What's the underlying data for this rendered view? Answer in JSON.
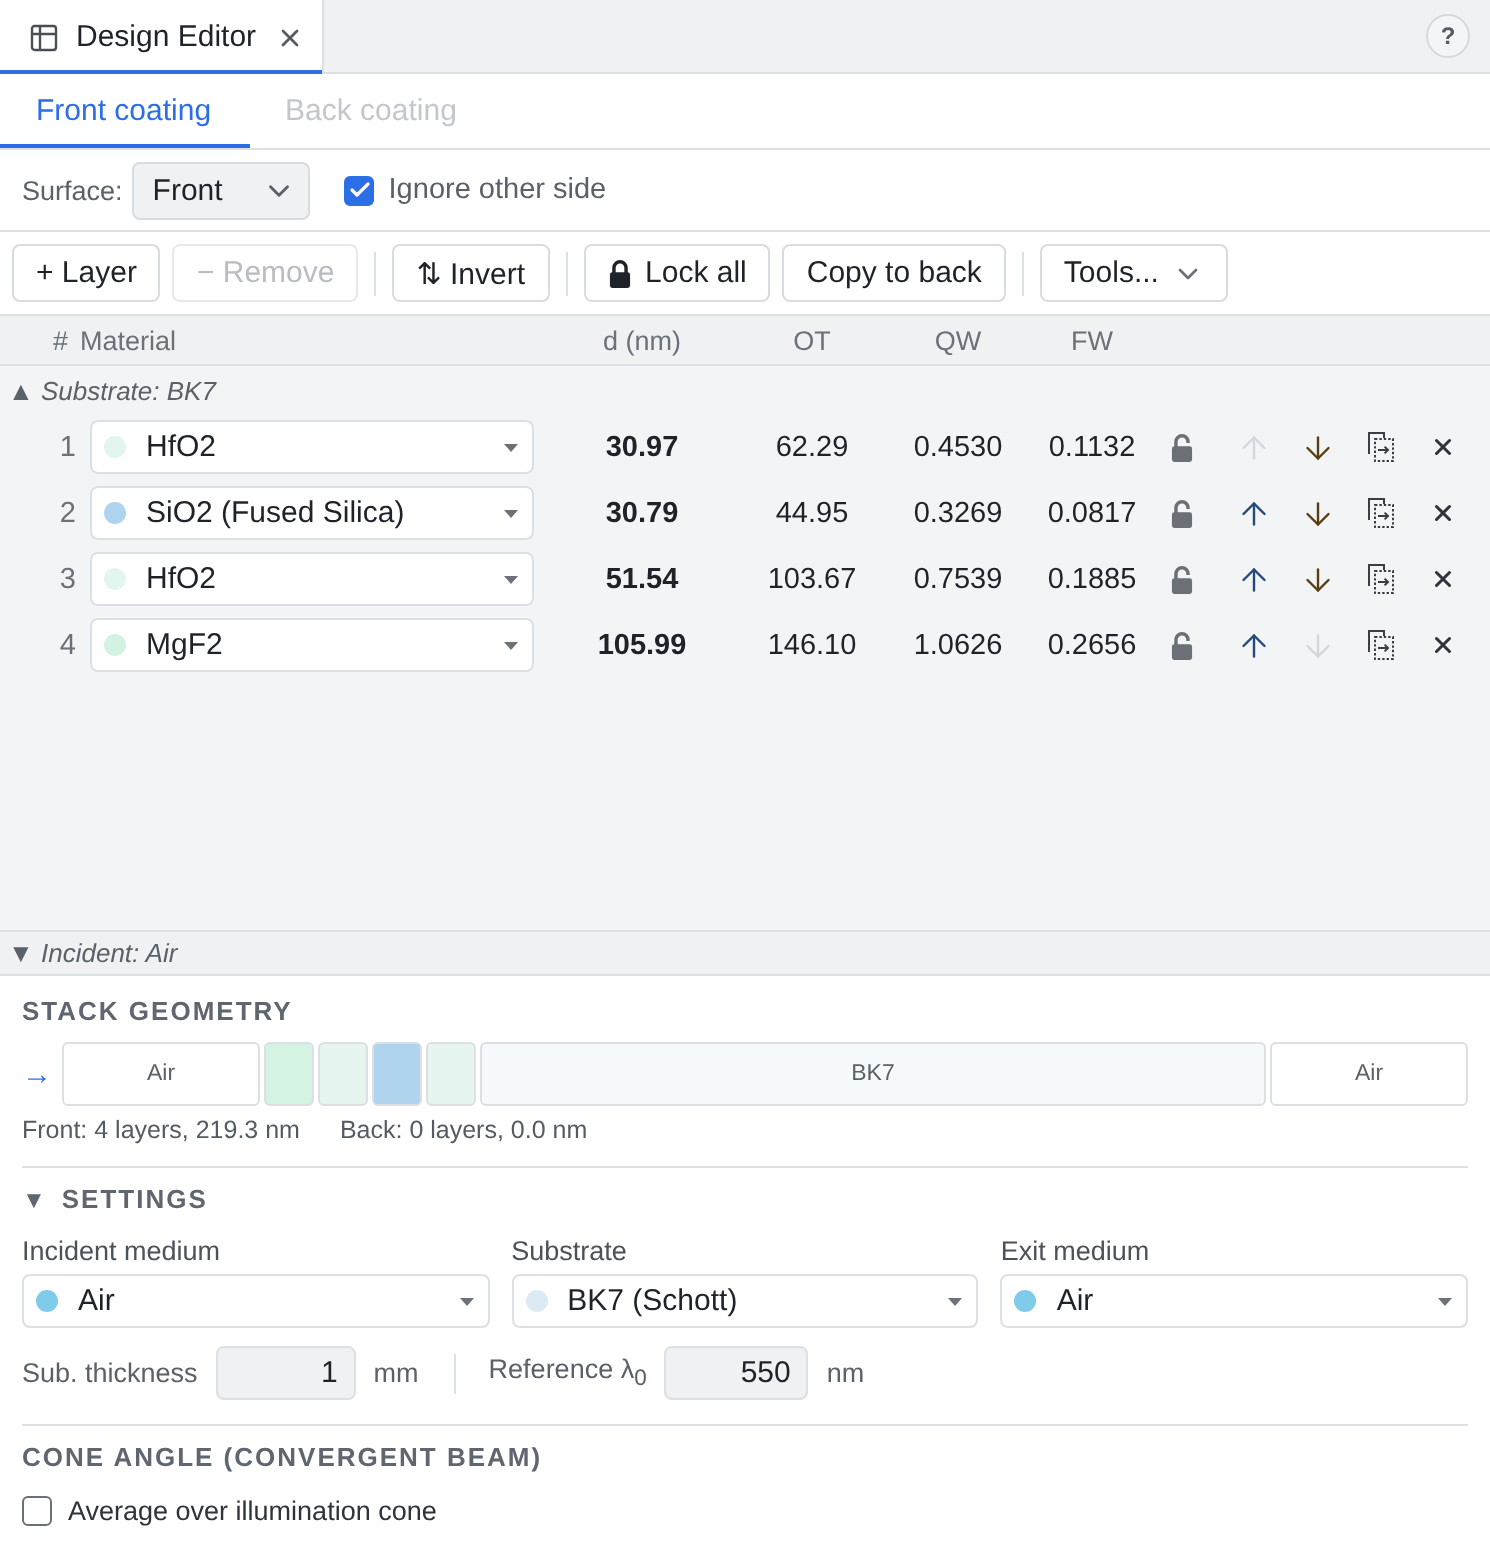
{
  "editor_tab": {
    "title": "Design Editor",
    "selected": true
  },
  "help_button": {
    "label": "?"
  },
  "coating_tabs": [
    {
      "label": "Front coating",
      "selected": true,
      "disabled": false
    },
    {
      "label": "Back coating",
      "selected": false,
      "disabled": true
    }
  ],
  "surface": {
    "label": "Surface:",
    "value": "Front",
    "ignore_other_side": {
      "label": "Ignore other side",
      "checked": true
    }
  },
  "toolbar_groups": [
    {
      "buttons": [
        {
          "kind": "plain",
          "label": "+ Layer",
          "disabled": false
        },
        {
          "kind": "plain",
          "label": "− Remove",
          "disabled": true
        }
      ]
    },
    {
      "buttons": [
        {
          "kind": "plain",
          "label": "⇅ Invert",
          "disabled": false
        }
      ]
    },
    {
      "buttons": [
        {
          "kind": "lock",
          "label": "Lock all",
          "disabled": false
        },
        {
          "kind": "plain",
          "label": "Copy to back",
          "disabled": false
        }
      ]
    },
    {
      "buttons": [
        {
          "kind": "menu",
          "label": "Tools...",
          "disabled": false
        }
      ]
    }
  ],
  "table": {
    "columns": [
      "#",
      "Material",
      "d (nm)",
      "OT",
      "QW",
      "FW"
    ],
    "substrate": {
      "glyph": "▲",
      "label": "Substrate: BK7"
    },
    "rows": [
      {
        "index": "1",
        "material": "HfO2",
        "color": "#e3f5ef",
        "d": "30.97",
        "ot": "62.29",
        "qw": "0.4530",
        "fw": "0.1132",
        "locked": false,
        "can_move_up": false,
        "can_move_down": true
      },
      {
        "index": "2",
        "material": "SiO2 (Fused Silica)",
        "color": "#aed3ef",
        "d": "30.79",
        "ot": "44.95",
        "qw": "0.3269",
        "fw": "0.0817",
        "locked": false,
        "can_move_up": true,
        "can_move_down": true
      },
      {
        "index": "3",
        "material": "HfO2",
        "color": "#e3f5ef",
        "d": "51.54",
        "ot": "103.67",
        "qw": "0.7539",
        "fw": "0.1885",
        "locked": false,
        "can_move_up": true,
        "can_move_down": true
      },
      {
        "index": "4",
        "material": "MgF2",
        "color": "#d3f2e1",
        "d": "105.99",
        "ot": "146.10",
        "qw": "1.0626",
        "fw": "0.2656",
        "locked": false,
        "can_move_up": true,
        "can_move_down": false
      }
    ],
    "incident": {
      "glyph": "▼",
      "label": "Incident: Air"
    }
  },
  "stack_geometry": {
    "title": "STACK GEOMETRY",
    "arrow": "→",
    "segments": [
      {
        "kind": "medium",
        "label": "Air",
        "color": "#ffffff"
      },
      {
        "kind": "layer",
        "color": "#d4f3e2"
      },
      {
        "kind": "layer",
        "color": "#e6f5f0"
      },
      {
        "kind": "layer",
        "color": "#b0d4ee"
      },
      {
        "kind": "layer",
        "color": "#e6f5f0"
      },
      {
        "kind": "substrate",
        "label": "BK7",
        "color": "#f5f9fb"
      },
      {
        "kind": "medium",
        "label": "Air",
        "color": "#ffffff"
      }
    ],
    "front_summary": "Front: 4 layers, 219.3 nm",
    "back_summary": "Back: 0 layers, 0.0 nm"
  },
  "settings": {
    "glyph": "▼",
    "title": "SETTINGS",
    "media": [
      {
        "label": "Incident medium",
        "value": "Air",
        "color": "#7ecbea"
      },
      {
        "label": "Substrate",
        "value": "BK7 (Schott)",
        "color": "#dceaf6"
      },
      {
        "label": "Exit medium",
        "value": "Air",
        "color": "#7ecbea"
      }
    ],
    "sub_thickness": {
      "label": "Sub. thickness",
      "value": "1",
      "unit": "mm"
    },
    "reference_wavelength": {
      "label": "Reference λ$_{0}$",
      "value": "550",
      "unit": "nm"
    }
  },
  "cone_angle": {
    "title": "CONE ANGLE (CONVERGENT BEAM)",
    "average": {
      "label": "Average over illumination cone",
      "checked": false
    }
  }
}
